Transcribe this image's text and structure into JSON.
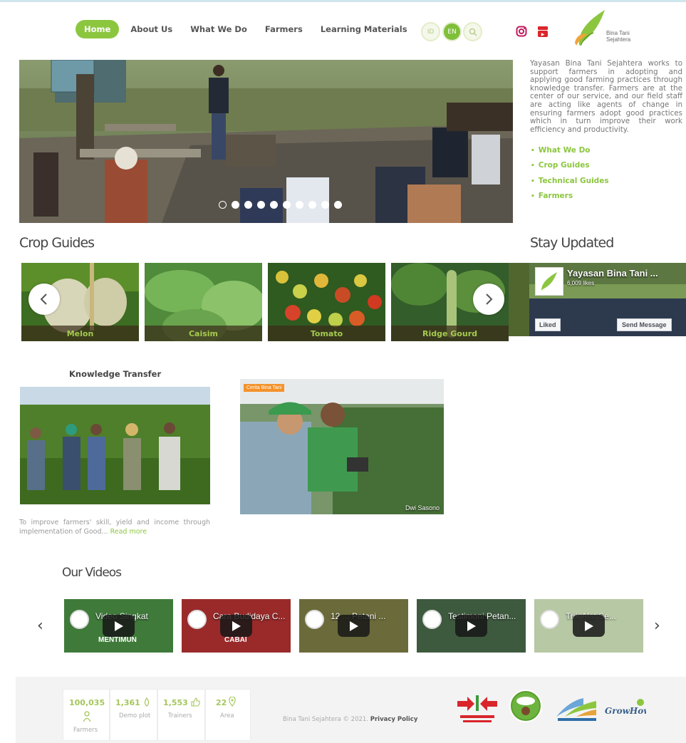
{
  "nav": {
    "items": [
      {
        "label": "Home"
      },
      {
        "label": "About Us"
      },
      {
        "label": "What We Do"
      },
      {
        "label": "Farmers"
      },
      {
        "label": "Learning Materials"
      }
    ],
    "lang_id": "ID",
    "lang_en": "EN"
  },
  "brand": {
    "line1": "Bina Tani",
    "line2": "Sejahtera",
    "accent_color": "#8cc63f"
  },
  "hero": {
    "slides_total": 10,
    "active_slide": 1
  },
  "intro": {
    "text": "Yayasan Bina Tani Sejahtera works to support farmers in adopting and applying good farming practices through knowledge transfer. Farmers are at the center of our service, and our field staff are acting like agents of change in ensuring farmers adopt good practices which in turn improve their work efficiency and productivity.",
    "links": [
      {
        "label": "What We Do"
      },
      {
        "label": "Crop Guides"
      },
      {
        "label": "Technical Guides"
      },
      {
        "label": "Farmers"
      }
    ]
  },
  "crop_guides": {
    "title": "Crop Guides",
    "items": [
      {
        "label": "Melon"
      },
      {
        "label": "Caisim"
      },
      {
        "label": "Tomato"
      },
      {
        "label": "Ridge Gourd"
      }
    ]
  },
  "stay_updated": {
    "title": "Stay Updated",
    "page_name": "Yayasan Bina Tani ...",
    "likes": "6,009 likes",
    "liked_label": "Liked",
    "send_label": "Send Message"
  },
  "knowledge": {
    "title": "Knowledge Transfer",
    "text": "To improve farmers' skill, yield and income through implementation of Good...",
    "more": "Read more",
    "photo_tag": "Cerita Bina Tani",
    "photo_credit": "Dwi Sasono"
  },
  "videos": {
    "title": "Our Videos",
    "items": [
      {
        "title": "Video Singkat",
        "subtitle": "MENTIMUN"
      },
      {
        "title": "Cara Budidaya C...",
        "subtitle": "CABAI"
      },
      {
        "title": "12 ... Petani ...",
        "subtitle": ""
      },
      {
        "title": "Testimoni Petan...",
        "subtitle": ""
      },
      {
        "title": "Trik Alat Se...",
        "subtitle": ""
      }
    ]
  },
  "footer": {
    "stats": [
      {
        "value": "100,035",
        "label": "Farmers"
      },
      {
        "value": "1,361",
        "label": "Demo plot"
      },
      {
        "value": "1,553",
        "label": "Trainers"
      },
      {
        "value": "22",
        "label": "Area"
      }
    ],
    "copyright": "Bina Tani Sejahtera © 2021.",
    "privacy": "Privacy Policy",
    "partners": [
      {
        "name": "EAST-WEST SEED"
      },
      {
        "name": "Spindo"
      },
      {
        "name": "vegIMPACT NL"
      },
      {
        "name": "GrowHow"
      }
    ]
  }
}
